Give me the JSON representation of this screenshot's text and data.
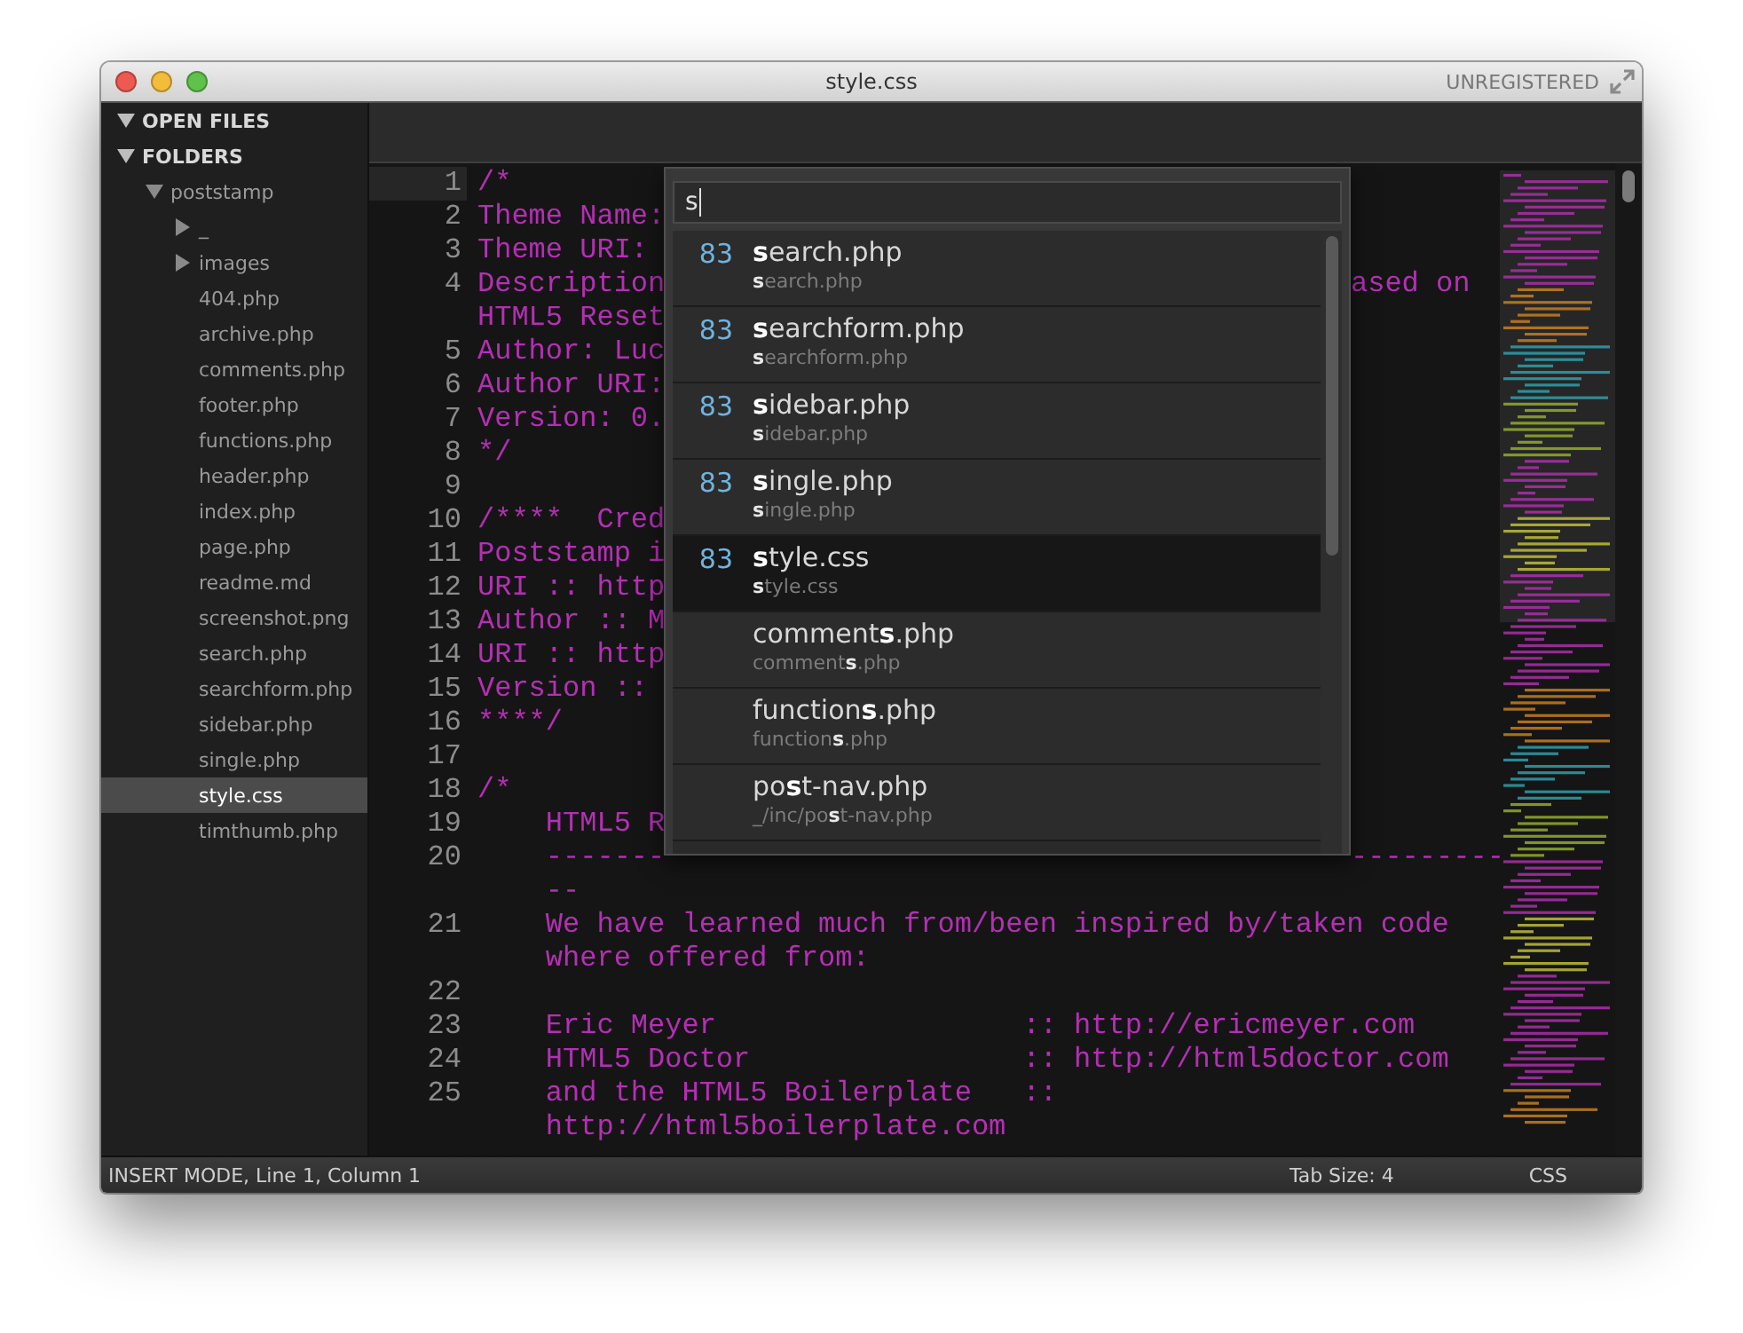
{
  "window": {
    "title": "style.css",
    "badge": "UNREGISTERED"
  },
  "sidebar": {
    "tree": [
      {
        "label": "OPEN FILES",
        "kind": "section",
        "expanded": true,
        "selected": false
      },
      {
        "label": "FOLDERS",
        "kind": "section",
        "expanded": true,
        "selected": false,
        "children": [
          {
            "label": "poststamp",
            "kind": "folder",
            "expanded": true,
            "selected": false,
            "children": [
              {
                "label": "_",
                "kind": "folder",
                "expanded": false,
                "selected": false
              },
              {
                "label": "images",
                "kind": "folder",
                "expanded": false,
                "selected": false
              },
              {
                "label": "404.php",
                "kind": "file",
                "selected": false
              },
              {
                "label": "archive.php",
                "kind": "file",
                "selected": false
              },
              {
                "label": "comments.php",
                "kind": "file",
                "selected": false
              },
              {
                "label": "footer.php",
                "kind": "file",
                "selected": false
              },
              {
                "label": "functions.php",
                "kind": "file",
                "selected": false
              },
              {
                "label": "header.php",
                "kind": "file",
                "selected": false
              },
              {
                "label": "index.php",
                "kind": "file",
                "selected": false
              },
              {
                "label": "page.php",
                "kind": "file",
                "selected": false
              },
              {
                "label": "readme.md",
                "kind": "file",
                "selected": false
              },
              {
                "label": "screenshot.png",
                "kind": "file",
                "selected": false
              },
              {
                "label": "search.php",
                "kind": "file",
                "selected": false
              },
              {
                "label": "searchform.php",
                "kind": "file",
                "selected": false
              },
              {
                "label": "sidebar.php",
                "kind": "file",
                "selected": false
              },
              {
                "label": "single.php",
                "kind": "file",
                "selected": false
              },
              {
                "label": "style.css",
                "kind": "file",
                "selected": true
              },
              {
                "label": "timthumb.php",
                "kind": "file",
                "selected": false
              }
            ]
          }
        ]
      }
    ]
  },
  "editor": {
    "lines": [
      {
        "number": "1",
        "current": true,
        "rows": [
          {
            "text": "/*"
          }
        ]
      },
      {
        "number": "2",
        "current": false,
        "rows": [
          {
            "text": "Theme Name:"
          }
        ]
      },
      {
        "number": "3",
        "current": false,
        "rows": [
          {
            "text": "Theme URI:"
          }
        ]
      },
      {
        "number": "4",
        "current": false,
        "rows": [
          {
            "text": "Description",
            "after": "ased on"
          },
          {
            "text": "HTML5 Reset"
          }
        ]
      },
      {
        "number": "5",
        "current": false,
        "rows": [
          {
            "text": "Author: Luc"
          }
        ]
      },
      {
        "number": "6",
        "current": false,
        "rows": [
          {
            "text": "Author URI:"
          }
        ]
      },
      {
        "number": "7",
        "current": false,
        "rows": [
          {
            "text": "Version: 0."
          }
        ]
      },
      {
        "number": "8",
        "current": false,
        "rows": [
          {
            "text": "*/"
          }
        ]
      },
      {
        "number": "9",
        "current": false
      },
      {
        "number": "10",
        "current": false,
        "rows": [
          {
            "text": "/****  Cred"
          }
        ]
      },
      {
        "number": "11",
        "current": false,
        "rows": [
          {
            "text": "Poststamp i"
          }
        ]
      },
      {
        "number": "12",
        "current": false,
        "rows": [
          {
            "text": "URI :: http"
          }
        ]
      },
      {
        "number": "13",
        "current": false,
        "rows": [
          {
            "text": "Author :: M"
          }
        ]
      },
      {
        "number": "14",
        "current": false,
        "rows": [
          {
            "text": "URI :: http"
          }
        ]
      },
      {
        "number": "15",
        "current": false,
        "rows": [
          {
            "text": "Version ::"
          }
        ]
      },
      {
        "number": "16",
        "current": false,
        "rows": [
          {
            "text": "****/"
          }
        ]
      },
      {
        "number": "17",
        "current": false
      },
      {
        "number": "18",
        "current": false,
        "rows": [
          {
            "text": "/*"
          }
        ]
      },
      {
        "number": "19",
        "current": false,
        "rows": [
          {
            "text": "    HTML5 R"
          }
        ]
      },
      {
        "number": "20",
        "current": false,
        "rows": [
          {
            "text": "    -------",
            "after": "---------"
          },
          {
            "text": "    --"
          }
        ]
      },
      {
        "number": "21",
        "current": false,
        "rows": [
          {
            "text": "    We have learned much from/been inspired by/taken code"
          },
          {
            "text": "    where offered from:"
          }
        ]
      },
      {
        "number": "22",
        "current": false
      },
      {
        "number": "23",
        "current": false,
        "rows": [
          {
            "text": "    Eric Meyer                  :: http://ericmeyer.com"
          }
        ]
      },
      {
        "number": "24",
        "current": false,
        "rows": [
          {
            "text": "    HTML5 Doctor                :: http://html5doctor.com"
          }
        ]
      },
      {
        "number": "25",
        "current": false,
        "rows": [
          {
            "text": "    and the HTML5 Boilerplate   ::"
          },
          {
            "text": "    http://html5boilerplate.com"
          }
        ]
      }
    ]
  },
  "quick_open": {
    "query": "s",
    "results": [
      {
        "score": "83",
        "title": "**s**earch.php",
        "path": "**s**earch.php",
        "selected": false
      },
      {
        "score": "83",
        "title": "**s**earchform.php",
        "path": "**s**earchform.php",
        "selected": false
      },
      {
        "score": "83",
        "title": "**s**idebar.php",
        "path": "**s**idebar.php",
        "selected": false
      },
      {
        "score": "83",
        "title": "**s**ingle.php",
        "path": "**s**ingle.php",
        "selected": false
      },
      {
        "score": "83",
        "title": "**s**tyle.css",
        "path": "**s**tyle.css",
        "selected": true
      },
      {
        "title": "comment**s**.php",
        "path": "comment**s**.php",
        "selected": false
      },
      {
        "title": "function**s**.php",
        "path": "function**s**.php",
        "selected": false
      },
      {
        "title": "po**s**t-nav.php",
        "path": "_/inc/po**s**t-nav.php",
        "selected": false
      }
    ]
  },
  "status_bar": {
    "mode": "INSERT MODE, Line 1, Column 1",
    "tab_size": "Tab Size: 4",
    "syntax": "CSS"
  }
}
